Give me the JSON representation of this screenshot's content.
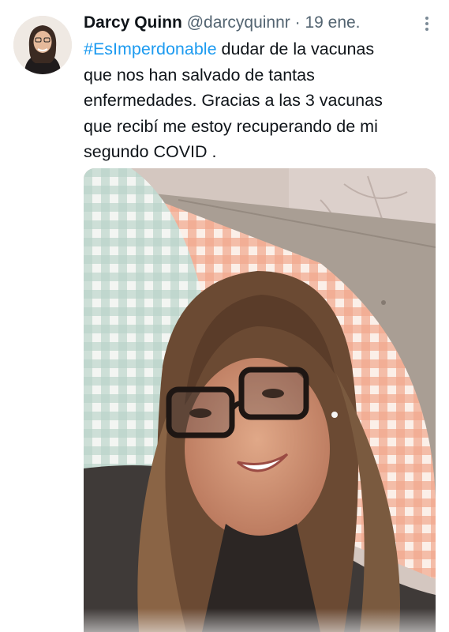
{
  "tweet": {
    "author_name": "Darcy Quinn",
    "handle": "@darcyquinnr",
    "separator": "·",
    "date": "19 ene.",
    "hashtag": "#EsImperdonable",
    "body_lines": [
      " dudar de la vacunas",
      "que nos han salvado de tantas",
      "enfermedades.  Gracias a las 3 vacunas",
      "que recibí me estoy recuperando de mi",
      "segundo COVID ."
    ]
  },
  "colors": {
    "hashtag": "#1d9bf0",
    "secondary_text": "#536471",
    "primary_text": "#0f1419"
  },
  "icons": {
    "more": "more-dots-vertical-icon"
  }
}
